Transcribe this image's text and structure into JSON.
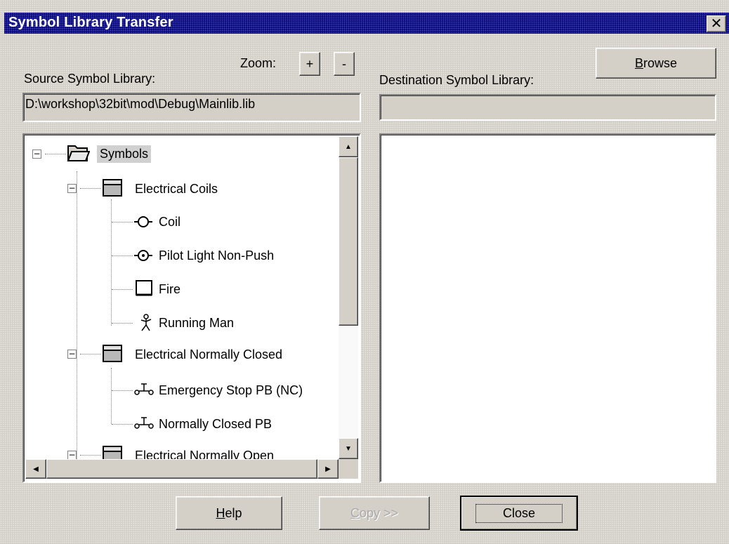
{
  "window": {
    "title": "Symbol Library Transfer",
    "close_glyph": "✕"
  },
  "zoom": {
    "label": "Zoom:",
    "plus": "+",
    "minus": "-"
  },
  "browse": {
    "label_pre": "",
    "label_u": "B",
    "label_post": "rowse"
  },
  "source": {
    "label": "Source Symbol Library:",
    "path": "D:\\workshop\\32bit\\mod\\Debug\\Mainlib.lib"
  },
  "destination": {
    "label": "Destination Symbol Library:",
    "path": ""
  },
  "tree": {
    "root": "Symbols",
    "groups": [
      {
        "label": "Electrical Coils",
        "items": [
          {
            "label": "Coil",
            "icon": "coil-icon"
          },
          {
            "label": "Pilot Light Non-Push",
            "icon": "pilot-light-icon"
          },
          {
            "label": "Fire",
            "icon": "fire-icon"
          },
          {
            "label": "Running Man",
            "icon": "running-man-icon"
          }
        ]
      },
      {
        "label": "Electrical Normally Closed",
        "items": [
          {
            "label": "Emergency Stop PB (NC)",
            "icon": "nc-pushbutton-icon"
          },
          {
            "label": "Normally Closed PB",
            "icon": "nc-pushbutton-icon"
          }
        ]
      },
      {
        "label": "Electrical Normally Open",
        "items": []
      }
    ]
  },
  "buttons": {
    "help": {
      "u": "H",
      "rest": "elp"
    },
    "copy": {
      "u": "C",
      "rest": "opy >>"
    },
    "close": "Close"
  },
  "colors": {
    "face": "#d4d0c8",
    "title_bar": "#0a0a80",
    "panel_bg": "#ffffff"
  }
}
